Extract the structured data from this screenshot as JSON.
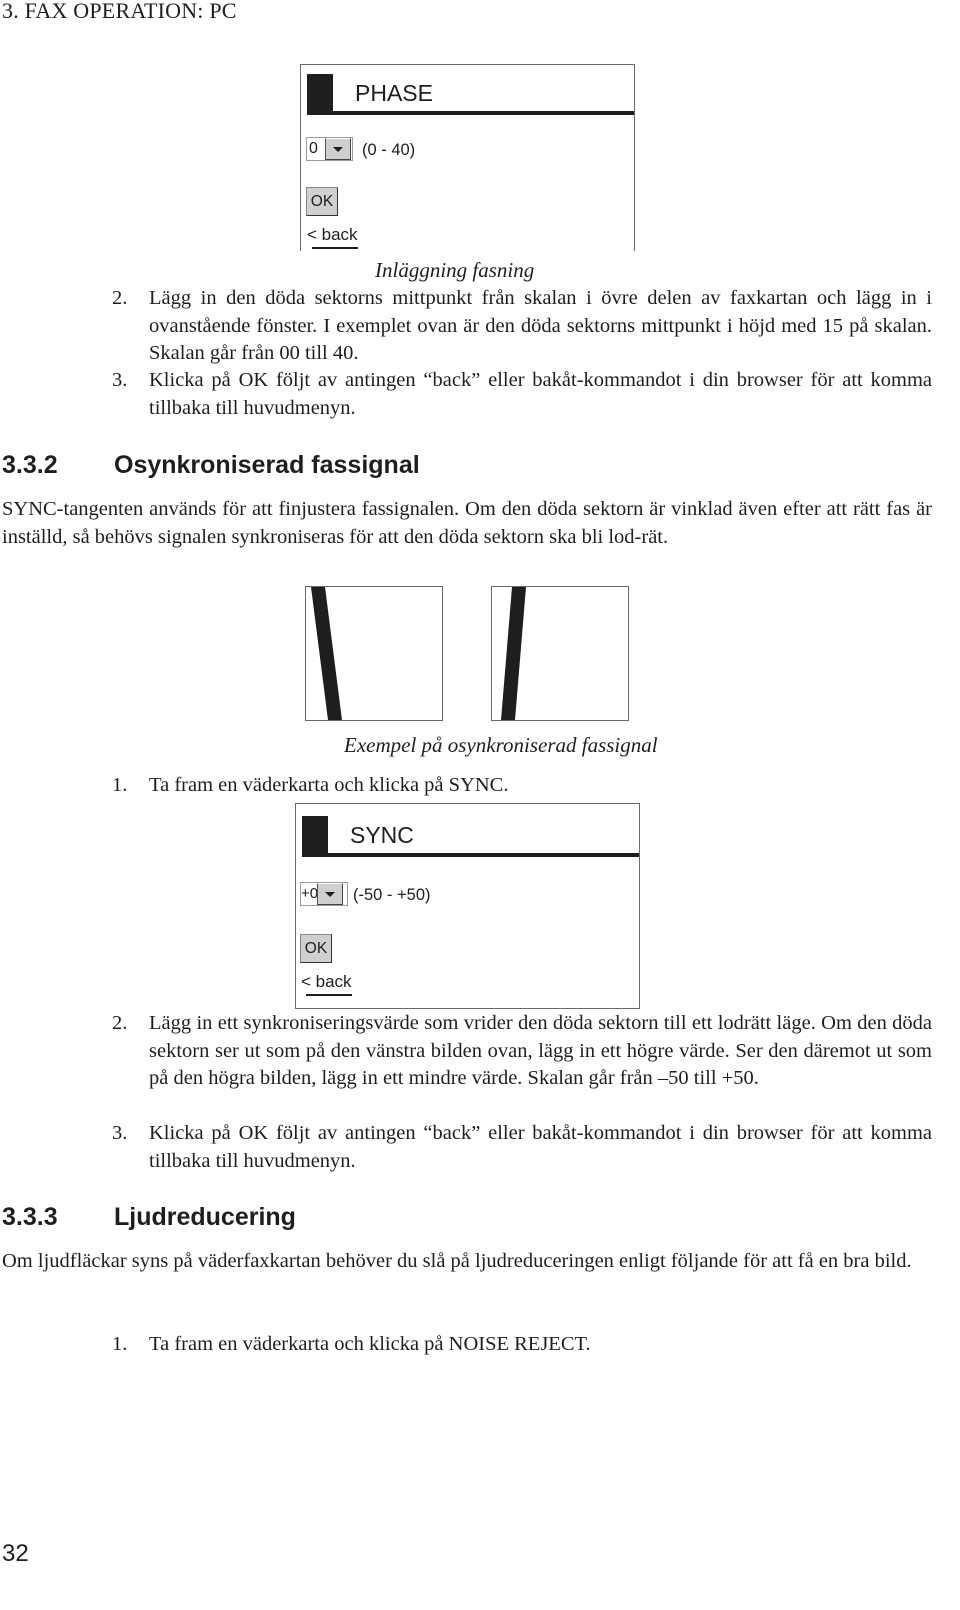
{
  "running_header": "3. FAX OPERATION: PC",
  "phase_dialog": {
    "title": "PHASE",
    "select_value": "0",
    "range": "(0 - 40)",
    "ok_label": "OK",
    "back_label": "< back"
  },
  "phase_caption": "Inläggning fasning",
  "phase_steps": [
    {
      "num": "2.",
      "text": "Lägg in den döda sektorns mittpunkt från skalan i övre delen av faxkartan och lägg in i ovanstående fönster. I exemplet ovan är den döda sektorns mittpunkt i höjd med 15 på skalan. Skalan går från 00 till 40."
    },
    {
      "num": "3.",
      "text": "Klicka på OK följt av antingen “back” eller bakåt-kommandot i din browser för att komma tillbaka till huvudmenyn."
    }
  ],
  "section_332": {
    "number": "3.3.2",
    "title": "Osynkroniserad fassignal",
    "intro": "SYNC-tangenten används för att finjustera fassignalen. Om den döda sektorn är vinklad även efter att rätt fas är inställd, så behövs signalen synkroniseras för att den döda sektorn ska bli lod-rät.",
    "figure_caption": "Exempel på osynkroniserad fassignal",
    "step1": {
      "num": "1.",
      "text": "Ta fram en väderkarta och klicka på SYNC."
    }
  },
  "sync_dialog": {
    "title": "SYNC",
    "select_value": "+0",
    "range": "(-50 - +50)",
    "ok_label": "OK",
    "back_label": "< back"
  },
  "sync_steps": [
    {
      "num": "2.",
      "text": "Lägg in ett synkroniseringsvärde som vrider den döda sektorn till ett lodrätt läge. Om den döda sektorn ser ut som på den vänstra bilden ovan, lägg in ett högre värde. Ser den däremot ut som på den högra bilden, lägg in ett mindre värde. Skalan går från –50 till +50."
    },
    {
      "num": "3.",
      "text": "Klicka på OK följt av antingen “back” eller bakåt-kommandot i din browser för att komma tillbaka till huvudmenyn."
    }
  ],
  "section_333": {
    "number": "3.3.3",
    "title": "Ljudreducering",
    "intro": "Om ljudfläckar syns på väderfaxkartan behöver du slå på ljudreduceringen enligt följande för att få en bra bild.",
    "step1": {
      "num": "1.",
      "text": "Ta fram en väderkarta och klicka på NOISE REJECT."
    }
  },
  "page_number": "32"
}
